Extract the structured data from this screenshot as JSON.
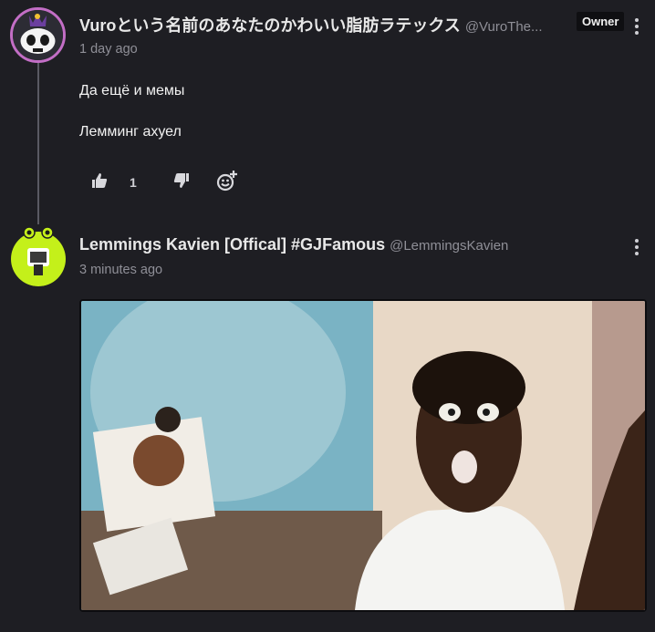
{
  "comments": [
    {
      "author": "Vuroという名前のあなたのかわいい脂肪ラテックス",
      "handle": "@VuroThe...",
      "badge": "Owner",
      "time": "1 day ago",
      "lines": [
        "Да ещё и мемы",
        "Лемминг ахуел"
      ],
      "like_count": "1"
    },
    {
      "author": "Lemmings Kavien [Offical] #GJFamous",
      "handle": "@LemmingsKavien",
      "time": "3 minutes ago"
    }
  ],
  "icons": {
    "like": "thumbs-up-icon",
    "dislike": "thumbs-down-icon",
    "emoji": "add-reaction-icon",
    "more": "more-options-icon"
  },
  "colors": {
    "background": "#1e1e23",
    "avatar_ring": "#c36ec6",
    "avatar2_bg": "#c4f01a"
  }
}
